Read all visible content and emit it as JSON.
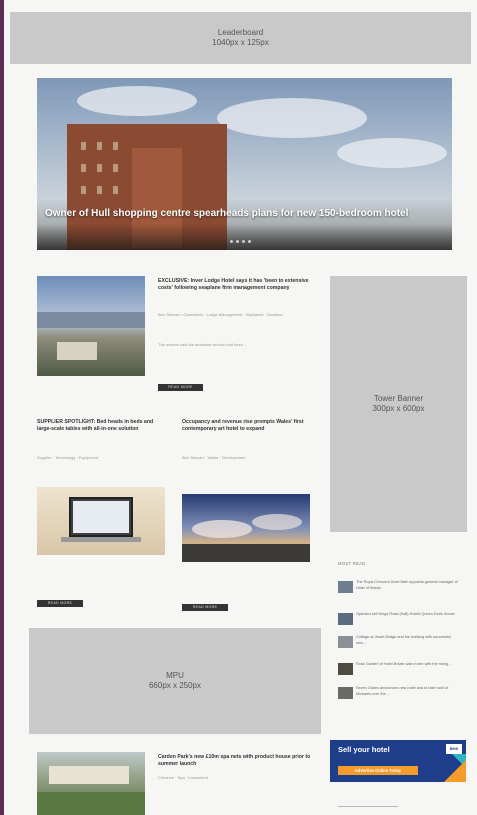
{
  "leaderboard": {
    "line1": "Leaderboard",
    "line2": "1040px x 125px"
  },
  "hero": {
    "title": "Owner of Hull shopping centre spearheads plans for new 150-bedroom hotel"
  },
  "articles": [
    {
      "headline": "EXCLUSIVE: Inver Lodge Hotel says it has 'been to extensive costs' following seaplane firm management company",
      "meta": "Ben Stewart • Operations · Lodge Management · Highlands · Scotland",
      "excerpt": "The owners said the seaplane service had been ...",
      "button": "READ MORE"
    },
    {
      "headline": "SUPPLIER SPOTLIGHT: Bed heads in beds and large-scale tables with all-in-one solution",
      "meta": "Supplier · Technology · Equipment",
      "excerpt": "",
      "button": "READ MORE"
    },
    {
      "headline": "Occupancy and revenue rise prompts Wales' first contemporary art hotel to expand",
      "meta": "Ben Stewart · Wales · Development",
      "excerpt": "",
      "button": "READ MORE"
    },
    {
      "headline": "Carden Park's new £10m spa nets with product house prior to summer launch",
      "meta": "Cheshire · Spa · Investment",
      "excerpt": ""
    }
  ],
  "tower": {
    "line1": "Tower Banner",
    "line2": "300px x 600px"
  },
  "mpu": {
    "line1": "MPU",
    "line2": "660px x 250px"
  },
  "most_read": {
    "title": "MOST READ",
    "items": [
      "The Royal Crescent Hotel Bath appoints general manager of Hotel of Bristol",
      "Operator sell Kings Road (Hall) Hotels Queen Doris House",
      "Cottage at Jewel Bridge and the building with successful new ..",
      "Rose Garden of Hotel Britain sale in line with the rising ..",
      "Seven Oakes announces new hotel and to take hold of Michaels over the ..."
    ]
  },
  "sell": {
    "title": "Sell your hotel",
    "button": "Advertise Online Today",
    "badge": "BHS"
  }
}
